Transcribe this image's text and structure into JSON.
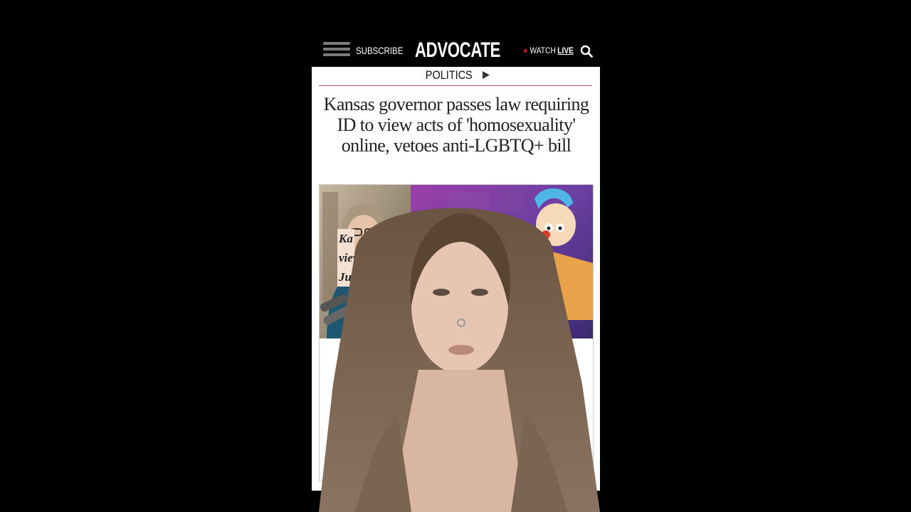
{
  "header": {
    "subscribe_label": "SUBSCRIBE",
    "logo_text": "ADVOCATE",
    "watch_label": "WATCH",
    "live_label": "LIVE"
  },
  "article": {
    "section": "POLITICS",
    "headline": "Kansas governor passes law requiring ID to view acts of 'homosexuality' online, vetoes anti-LGBTQ+ bill",
    "caption_lines": [
      "Ka",
      "view",
      "July"
    ]
  },
  "colors": {
    "background": "#000000",
    "page": "#ffffff",
    "section_rule": "#b04a55",
    "live_dot": "#dd1111"
  }
}
